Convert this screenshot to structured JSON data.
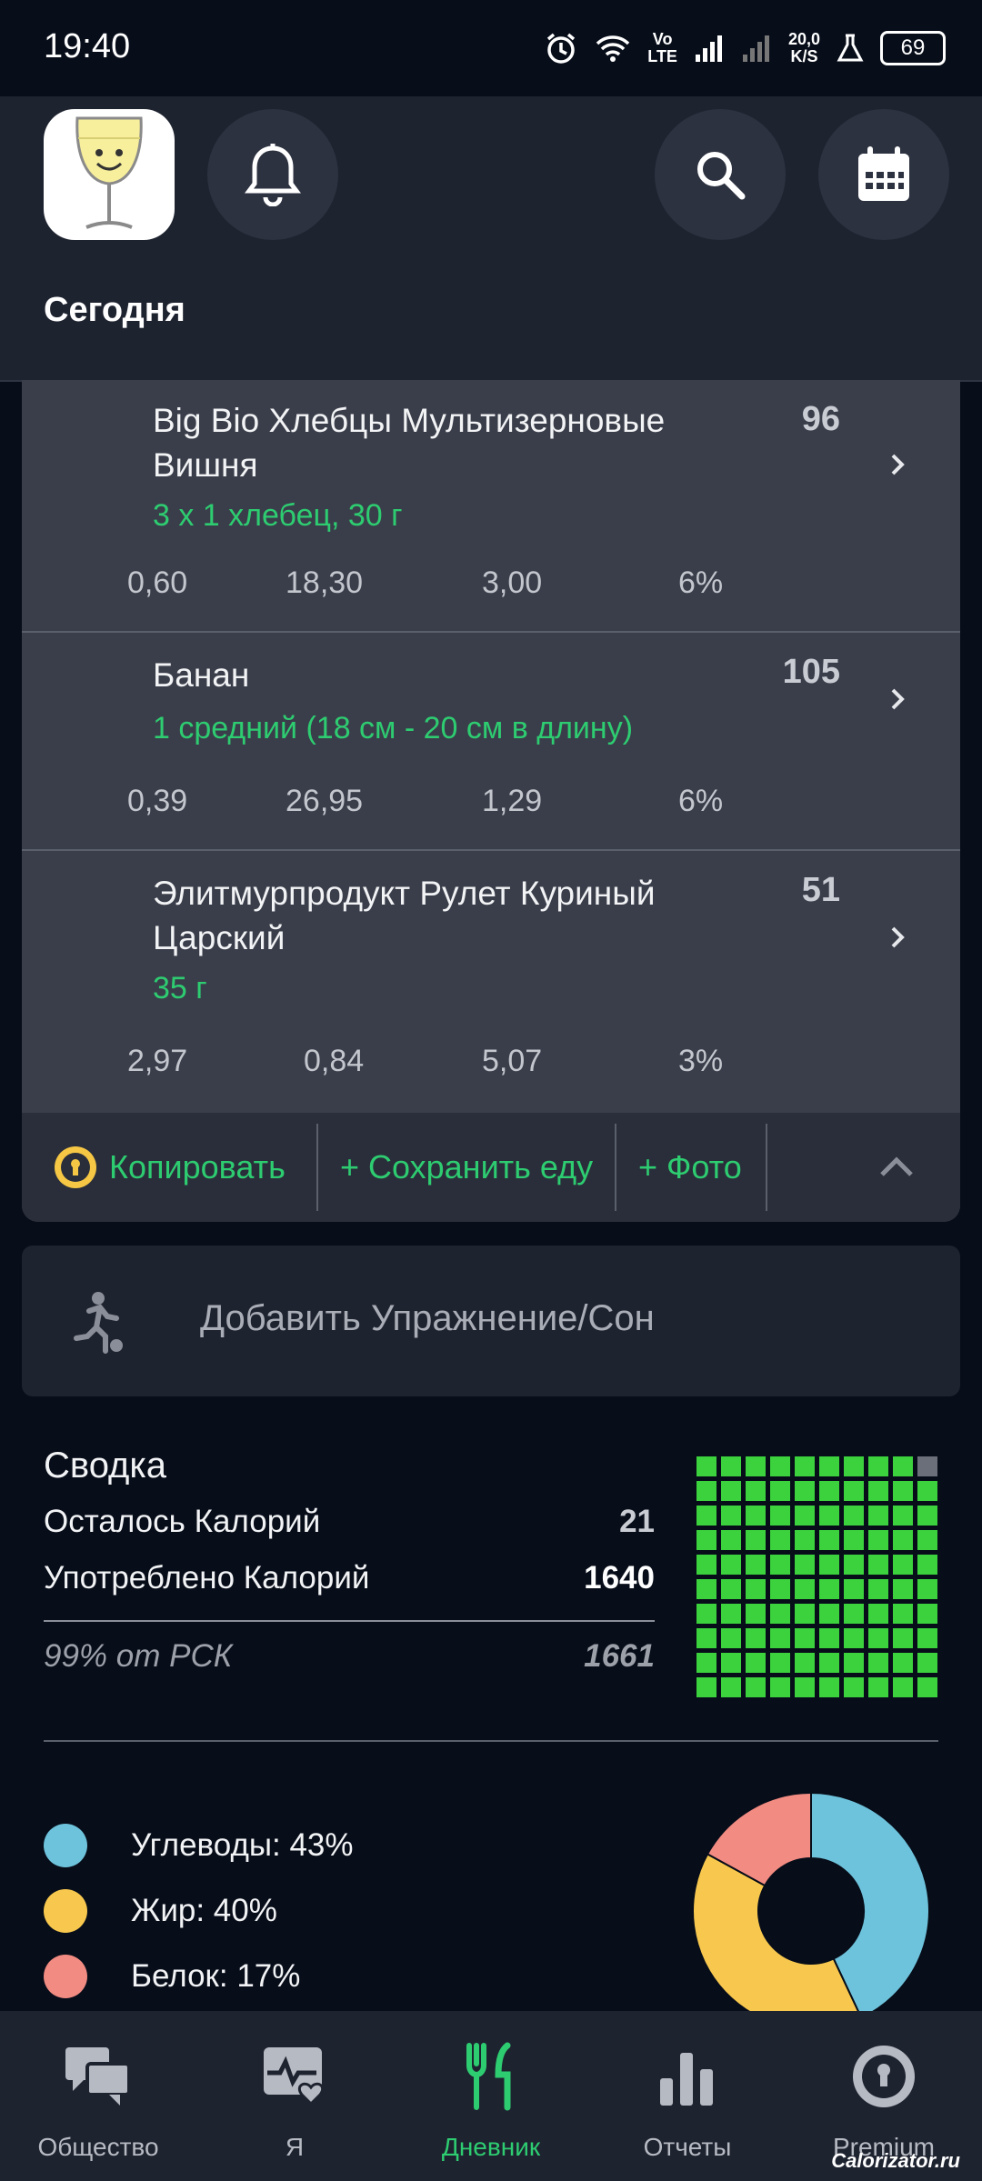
{
  "status_bar": {
    "time": "19:40",
    "volte_top": "Vo",
    "volte_bottom": "LTE",
    "speed_top": "20,0",
    "speed_bottom": "K/S",
    "battery": "69"
  },
  "header": {
    "title": "Сегодня"
  },
  "foods": [
    {
      "name": "Big Bio Хлебцы Мультизерновые Вишня",
      "calories": "96",
      "portion": "3 x 1 хлебец, 30 г",
      "nutrients": [
        "0,60",
        "18,30",
        "3,00",
        "6%"
      ]
    },
    {
      "name": "Банан",
      "calories": "105",
      "portion": "1 средний (18 см - 20 см в длину)",
      "nutrients": [
        "0,39",
        "26,95",
        "1,29",
        "6%"
      ]
    },
    {
      "name": "Элитмурпродукт  Рулет Куриный Царский",
      "calories": "51",
      "portion": "35 г",
      "nutrients": [
        "2,97",
        "0,84",
        "5,07",
        "3%"
      ]
    }
  ],
  "actions": {
    "copy": "Копировать",
    "save_food": "+ Сохранить еду",
    "photo": "+ Фото"
  },
  "exercise": {
    "label": "Добавить Упражнение/Сон"
  },
  "summary": {
    "title": "Сводка",
    "remaining_label": "Осталось Калорий",
    "remaining_value": "21",
    "consumed_label": "Употреблено Калорий",
    "consumed_value": "1640",
    "rsk_label": "99% от РСК",
    "rsk_value": "1661",
    "grid_filled_fraction": 0.99
  },
  "macros": [
    {
      "label": "Углеводы: 43%",
      "percent": 43,
      "color": "#6ec3dc"
    },
    {
      "label": "Жир: 40%",
      "percent": 40,
      "color": "#f8c84e"
    },
    {
      "label": "Белок: 17%",
      "percent": 17,
      "color": "#f28b82"
    }
  ],
  "nav": [
    {
      "label": "Общество",
      "icon": "chat-icon"
    },
    {
      "label": "Я",
      "icon": "heart-pulse-icon"
    },
    {
      "label": "Дневник",
      "icon": "fork-knife-icon",
      "active": true
    },
    {
      "label": "Отчеты",
      "icon": "bar-chart-icon"
    },
    {
      "label": "Premium",
      "icon": "premium-badge-icon"
    }
  ],
  "watermark": "Calorizator.ru",
  "colors": {
    "accent": "#2ecc71",
    "grid_fill": "#3bd23d"
  }
}
